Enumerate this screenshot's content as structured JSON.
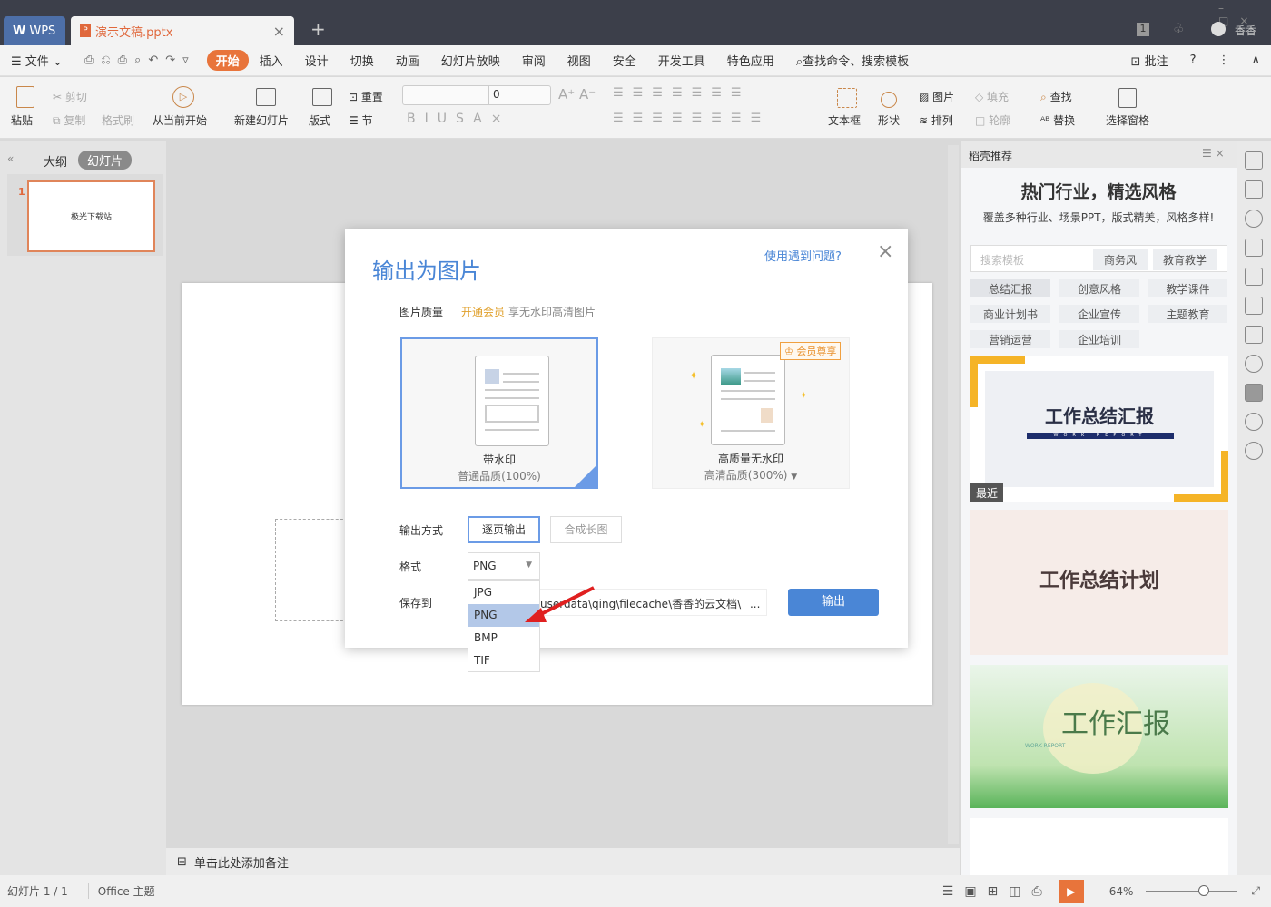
{
  "titlebar": {
    "wps_tab": "WPS",
    "doc_tab": "演示文稿.pptx",
    "new_tab": "+",
    "badge": "1",
    "user": "香香",
    "close": "×"
  },
  "menubar": {
    "file": "文件",
    "tabs": [
      "开始",
      "插入",
      "设计",
      "切换",
      "动画",
      "幻灯片放映",
      "审阅",
      "视图",
      "安全",
      "开发工具",
      "特色应用"
    ],
    "search": "查找命令、搜索模板",
    "comment": "批注",
    "help": "?"
  },
  "ribbon": {
    "paste": "粘贴",
    "cut": "剪切",
    "copy": "复制",
    "format_painter": "格式刷",
    "play_from_current": "从当前开始",
    "new_slide": "新建幻灯片",
    "layout": "版式",
    "reset": "重置",
    "section": "节",
    "font_size": "0",
    "textbox": "文本框",
    "shape": "形状",
    "picture": "图片",
    "arrange": "排列",
    "fill": "填充",
    "outline": "轮廓",
    "find": "查找",
    "replace": "替换",
    "selection_pane": "选择窗格"
  },
  "leftpanel": {
    "outline_tab": "大纲",
    "slides_tab": "幻灯片",
    "slide_number": "1",
    "thumb_text": "极光下载站"
  },
  "notes": {
    "placeholder": "单击此处添加备注"
  },
  "statusbar": {
    "slide": "幻灯片 1 / 1",
    "theme": "Office 主题",
    "zoom": "64%",
    "zoom_level": 64
  },
  "rightpanel": {
    "title": "稻壳推荐",
    "heading": "热门行业，精选风格",
    "subheading": "覆盖多种行业、场景PPT，版式精美，风格多样!",
    "search_placeholder": "搜索模板",
    "quick_tags": [
      "商务风",
      "教育教学"
    ],
    "tags": [
      "总结汇报",
      "创意风格",
      "教学课件",
      "商业计划书",
      "企业宣传",
      "主题教育",
      "营销运营",
      "企业培训"
    ],
    "templates": [
      {
        "title": "工作总结汇报",
        "sub": "WORK REPORT",
        "badge": "最近"
      },
      {
        "title": "工作总结计划"
      },
      {
        "title": "工作汇报",
        "sub": "WORK REPORT"
      }
    ]
  },
  "dialog": {
    "title": "输出为图片",
    "help_link": "使用遇到问题?",
    "quality_label": "图片质量",
    "vip_link": "开通会员",
    "vip_text": "享无水印高清图片",
    "option1_title": "带水印",
    "option1_sub": "普通品质(100%)",
    "option2_title": "高质量无水印",
    "option2_sub": "高清品质(300%)",
    "vip_badge": "会员尊享",
    "output_mode_label": "输出方式",
    "mode_single": "逐页输出",
    "mode_long": "合成长图",
    "format_label": "格式",
    "format_value": "PNG",
    "format_options": [
      "JPG",
      "PNG",
      "BMP",
      "TIF"
    ],
    "save_label": "保存到",
    "save_path": "userdata\\qing\\filecache\\香香的云文档\\",
    "browse": "...",
    "export_button": "输出"
  },
  "colors": {
    "accent": "#e8743b",
    "dialog_blue": "#4a86d6",
    "selection": "#6b9be6",
    "titlebar": "#3c3f4a"
  }
}
